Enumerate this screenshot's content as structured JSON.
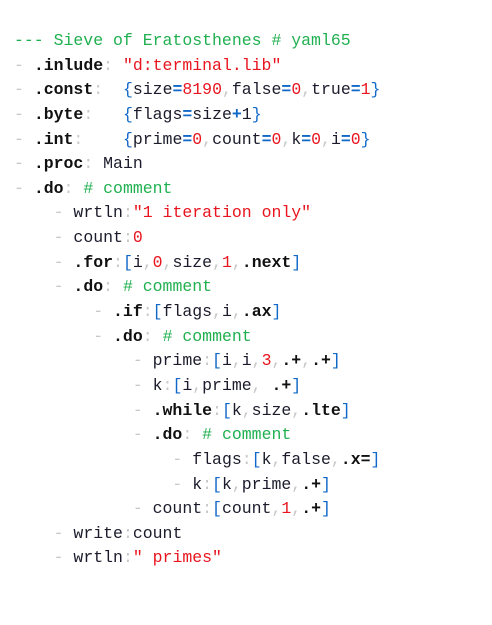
{
  "editor": {
    "lines": [
      [
        [
          "--- Sieve of Eratosthenes # yaml65",
          "m"
        ]
      ],
      [
        [
          "- ",
          "d"
        ],
        [
          ".inlude",
          "k"
        ],
        [
          ": ",
          "c"
        ],
        [
          "\"d:terminal.lib\"",
          "s"
        ]
      ],
      [
        [
          "- ",
          "d"
        ],
        [
          ".const",
          "k"
        ],
        [
          ":  ",
          "c"
        ],
        [
          "{",
          "b"
        ],
        [
          "size",
          "p"
        ],
        [
          "=",
          "o"
        ],
        [
          "8190",
          "n"
        ],
        [
          ",",
          "c"
        ],
        [
          "false",
          "p"
        ],
        [
          "=",
          "o"
        ],
        [
          "0",
          "n"
        ],
        [
          ",",
          "c"
        ],
        [
          "true",
          "p"
        ],
        [
          "=",
          "o"
        ],
        [
          "1",
          "n"
        ],
        [
          "}",
          "b"
        ]
      ],
      [
        [
          "- ",
          "d"
        ],
        [
          ".byte",
          "k"
        ],
        [
          ":   ",
          "c"
        ],
        [
          "{",
          "b"
        ],
        [
          "flags",
          "p"
        ],
        [
          "=",
          "o"
        ],
        [
          "size",
          "p"
        ],
        [
          "+",
          "o"
        ],
        [
          "1",
          "p"
        ],
        [
          "}",
          "b"
        ]
      ],
      [
        [
          "- ",
          "d"
        ],
        [
          ".int",
          "k"
        ],
        [
          ":    ",
          "c"
        ],
        [
          "{",
          "b"
        ],
        [
          "prime",
          "p"
        ],
        [
          "=",
          "o"
        ],
        [
          "0",
          "n"
        ],
        [
          ",",
          "c"
        ],
        [
          "count",
          "p"
        ],
        [
          "=",
          "o"
        ],
        [
          "0",
          "n"
        ],
        [
          ",",
          "c"
        ],
        [
          "k",
          "p"
        ],
        [
          "=",
          "o"
        ],
        [
          "0",
          "n"
        ],
        [
          ",",
          "c"
        ],
        [
          "i",
          "p"
        ],
        [
          "=",
          "o"
        ],
        [
          "0",
          "n"
        ],
        [
          "}",
          "b"
        ]
      ],
      [
        [
          "- ",
          "d"
        ],
        [
          ".proc",
          "k"
        ],
        [
          ": ",
          "c"
        ],
        [
          "Main",
          "p"
        ]
      ],
      [
        [
          "- ",
          "d"
        ],
        [
          ".do",
          "k"
        ],
        [
          ": ",
          "c"
        ],
        [
          "# comment",
          "m"
        ]
      ],
      [
        [
          "    - ",
          "d"
        ],
        [
          "wrtln",
          "p"
        ],
        [
          ":",
          "c"
        ],
        [
          "\"1 iteration only\"",
          "s"
        ]
      ],
      [
        [
          "    - ",
          "d"
        ],
        [
          "count",
          "p"
        ],
        [
          ":",
          "c"
        ],
        [
          "0",
          "n"
        ]
      ],
      [
        [
          "    - ",
          "d"
        ],
        [
          ".for",
          "k"
        ],
        [
          ":",
          "c"
        ],
        [
          "[",
          "b"
        ],
        [
          "i",
          "p"
        ],
        [
          ",",
          "c"
        ],
        [
          "0",
          "n"
        ],
        [
          ",",
          "c"
        ],
        [
          "size",
          "p"
        ],
        [
          ",",
          "c"
        ],
        [
          "1",
          "n"
        ],
        [
          ",",
          "c"
        ],
        [
          ".next",
          "k"
        ],
        [
          "]",
          "b"
        ]
      ],
      [
        [
          "    - ",
          "d"
        ],
        [
          ".do",
          "k"
        ],
        [
          ": ",
          "c"
        ],
        [
          "# comment",
          "m"
        ]
      ],
      [
        [
          "        - ",
          "d"
        ],
        [
          ".if",
          "k"
        ],
        [
          ":",
          "c"
        ],
        [
          "[",
          "b"
        ],
        [
          "flags",
          "p"
        ],
        [
          ",",
          "c"
        ],
        [
          "i",
          "p"
        ],
        [
          ",",
          "c"
        ],
        [
          ".ax",
          "k"
        ],
        [
          "]",
          "b"
        ]
      ],
      [
        [
          "        - ",
          "d"
        ],
        [
          ".do",
          "k"
        ],
        [
          ": ",
          "c"
        ],
        [
          "# comment",
          "m"
        ]
      ],
      [
        [
          "            - ",
          "d"
        ],
        [
          "prime",
          "p"
        ],
        [
          ":",
          "c"
        ],
        [
          "[",
          "b"
        ],
        [
          "i",
          "p"
        ],
        [
          ",",
          "c"
        ],
        [
          "i",
          "p"
        ],
        [
          ",",
          "c"
        ],
        [
          "3",
          "n"
        ],
        [
          ",",
          "c"
        ],
        [
          ".+",
          "k"
        ],
        [
          ",",
          "c"
        ],
        [
          ".+",
          "k"
        ],
        [
          "]",
          "b"
        ]
      ],
      [
        [
          "            - ",
          "d"
        ],
        [
          "k",
          "p"
        ],
        [
          ":",
          "c"
        ],
        [
          "[",
          "b"
        ],
        [
          "i",
          "p"
        ],
        [
          ",",
          "c"
        ],
        [
          "prime",
          "p"
        ],
        [
          ", ",
          "c"
        ],
        [
          ".+",
          "k"
        ],
        [
          "]",
          "b"
        ]
      ],
      [
        [
          "            - ",
          "d"
        ],
        [
          ".while",
          "k"
        ],
        [
          ":",
          "c"
        ],
        [
          "[",
          "b"
        ],
        [
          "k",
          "p"
        ],
        [
          ",",
          "c"
        ],
        [
          "size",
          "p"
        ],
        [
          ",",
          "c"
        ],
        [
          ".lte",
          "k"
        ],
        [
          "]",
          "b"
        ]
      ],
      [
        [
          "            - ",
          "d"
        ],
        [
          ".do",
          "k"
        ],
        [
          ": ",
          "c"
        ],
        [
          "# comment",
          "m"
        ]
      ],
      [
        [
          "                - ",
          "d"
        ],
        [
          "flags",
          "p"
        ],
        [
          ":",
          "c"
        ],
        [
          "[",
          "b"
        ],
        [
          "k",
          "p"
        ],
        [
          ",",
          "c"
        ],
        [
          "false",
          "p"
        ],
        [
          ",",
          "c"
        ],
        [
          ".x=",
          "k"
        ],
        [
          "]",
          "b"
        ]
      ],
      [
        [
          "                - ",
          "d"
        ],
        [
          "k",
          "p"
        ],
        [
          ":",
          "c"
        ],
        [
          "[",
          "b"
        ],
        [
          "k",
          "p"
        ],
        [
          ",",
          "c"
        ],
        [
          "prime",
          "p"
        ],
        [
          ",",
          "c"
        ],
        [
          ".+",
          "k"
        ],
        [
          "]",
          "b"
        ]
      ],
      [
        [
          "            - ",
          "d"
        ],
        [
          "count",
          "p"
        ],
        [
          ":",
          "c"
        ],
        [
          "[",
          "b"
        ],
        [
          "count",
          "p"
        ],
        [
          ",",
          "c"
        ],
        [
          "1",
          "n"
        ],
        [
          ",",
          "c"
        ],
        [
          ".+",
          "k"
        ],
        [
          "]",
          "b"
        ]
      ],
      [
        [
          "    - ",
          "d"
        ],
        [
          "write",
          "p"
        ],
        [
          ":",
          "c"
        ],
        [
          "count",
          "p"
        ]
      ],
      [
        [
          "    - ",
          "d"
        ],
        [
          "wrtln",
          "p"
        ],
        [
          ":",
          "c"
        ],
        [
          "\" primes\"",
          "s"
        ]
      ]
    ]
  }
}
